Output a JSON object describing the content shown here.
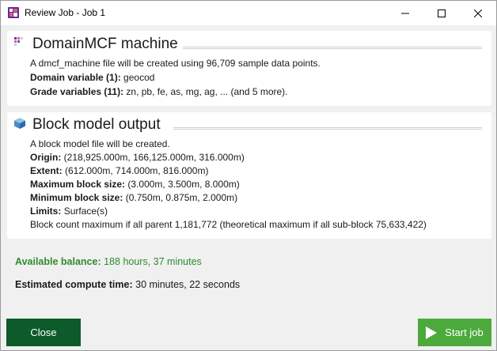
{
  "window": {
    "title": "Review Job - Job 1"
  },
  "domain_panel": {
    "title": "DomainMCF machine",
    "description": "A dmcf_machine file will be created using 96,709 sample data points.",
    "domain_variable_label": "Domain variable (1):",
    "domain_variable_value": "geocod",
    "grade_variables_label": "Grade variables (11):",
    "grade_variables_value": "zn, pb, fe, as, mg, ag, ... (and 5 more)."
  },
  "block_panel": {
    "title": "Block model output",
    "description": "A block model file will be created.",
    "origin_label": "Origin:",
    "origin_value": "(218,925.000m, 166,125.000m, 316.000m)",
    "extent_label": "Extent:",
    "extent_value": "(612.000m, 714.000m, 816.000m)",
    "max_block_label": "Maximum block size:",
    "max_block_value": "(3.000m, 3.500m, 8.000m)",
    "min_block_label": "Minimum block size:",
    "min_block_value": "(0.750m, 0.875m, 2.000m)",
    "limits_label": "Limits:",
    "limits_value": "Surface(s)",
    "block_count": "Block count maximum if all parent 1,181,772 (theoretical maximum if all sub-block 75,633,422)"
  },
  "balance": {
    "label": "Available balance:",
    "value": "188 hours, 37 minutes"
  },
  "compute": {
    "label": "Estimated compute time:",
    "value": "30 minutes, 22 seconds"
  },
  "buttons": {
    "close_label": "Close",
    "start_label": "Start job"
  },
  "colors": {
    "balance_green": "#2e8b2e",
    "close_button": "#0d5a2a",
    "start_button": "#4caa3c"
  }
}
